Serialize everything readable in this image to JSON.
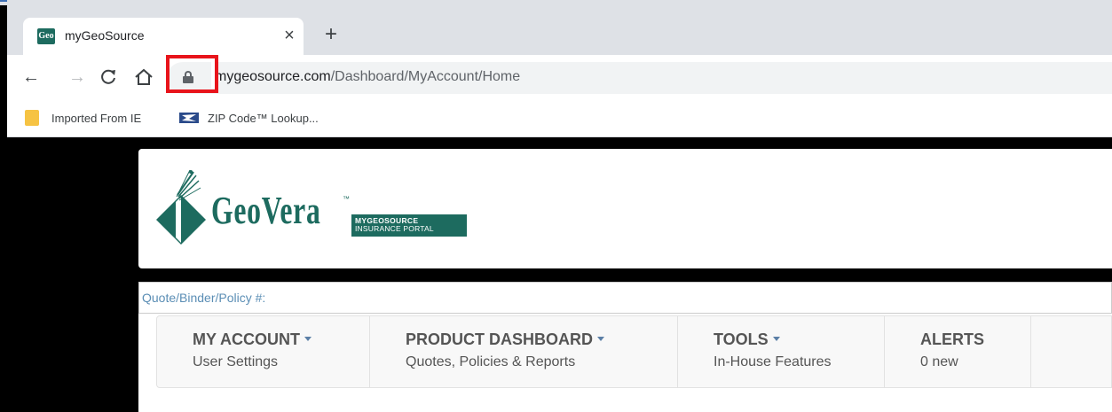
{
  "browser": {
    "tab": {
      "title": "myGeoSource",
      "favicon_text": "Geo",
      "close_icon": "close-icon"
    },
    "new_tab_icon": "plus-icon",
    "nav": {
      "back": "←",
      "forward": "→",
      "reload": "C",
      "home": "⌂"
    },
    "address": {
      "domain": "mygeosource.com",
      "path": "/Dashboard/MyAccount/Home"
    },
    "bookmarks": [
      {
        "label": "Imported From IE",
        "icon": "folder-icon"
      },
      {
        "label": "ZIP Code™ Lookup...",
        "icon": "usps-eagle-icon"
      }
    ]
  },
  "header": {
    "logo_word": "GeoVera",
    "logo_tm": "™",
    "badge_line1": "MYGEOSOURCE",
    "badge_line2": "INSURANCE PORTAL",
    "brand_color": "#1d6b5f"
  },
  "search": {
    "placeholder": "Quote/Binder/Policy #:"
  },
  "menu": [
    {
      "title": "MY ACCOUNT",
      "subtitle": "User Settings",
      "has_caret": true
    },
    {
      "title": "PRODUCT DASHBOARD",
      "subtitle": "Quotes, Policies & Reports",
      "has_caret": true
    },
    {
      "title": "TOOLS",
      "subtitle": "In-House Features",
      "has_caret": true
    },
    {
      "title": "ALERTS",
      "subtitle": "0 new",
      "has_caret": false
    }
  ],
  "annotation": {
    "highlight_color": "#e8141b",
    "target": "lock-icon"
  }
}
